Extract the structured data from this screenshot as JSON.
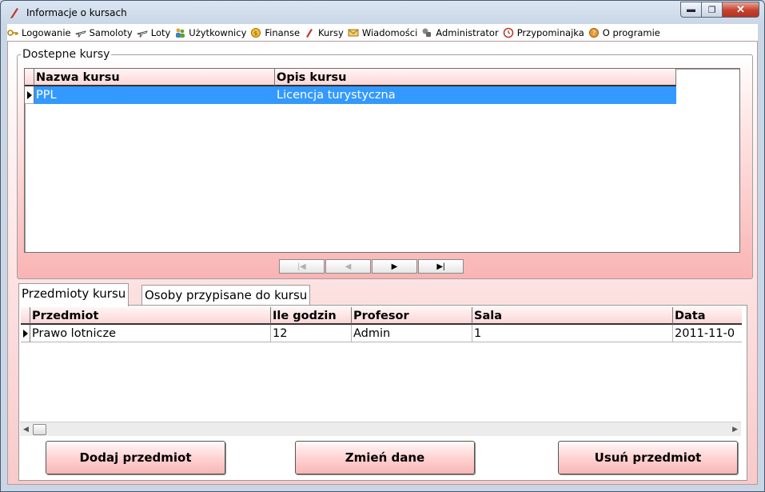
{
  "window": {
    "title": "Informacje o kursach"
  },
  "menu": [
    {
      "label": "Logowanie",
      "icon": "key-icon"
    },
    {
      "label": "Samoloty",
      "icon": "plane-icon"
    },
    {
      "label": "Loty",
      "icon": "plane-icon"
    },
    {
      "label": "Użytkownicy",
      "icon": "users-icon"
    },
    {
      "label": "Finanse",
      "icon": "coin-icon"
    },
    {
      "label": "Kursy",
      "icon": "pen-icon"
    },
    {
      "label": "Wiadomości",
      "icon": "envelope-icon"
    },
    {
      "label": "Administrator",
      "icon": "admin-icon"
    },
    {
      "label": "Przypominajka",
      "icon": "clock-icon"
    },
    {
      "label": "O programie",
      "icon": "info-icon"
    }
  ],
  "courses": {
    "group_title": "Dostepne kursy",
    "columns": [
      "Nazwa kursu",
      "Opis kursu"
    ],
    "rows": [
      [
        "PPL",
        "Licencja turystyczna"
      ]
    ],
    "nav": {
      "first": "|◀",
      "prev": "◀",
      "next": "▶",
      "last": "▶|"
    }
  },
  "tabs": [
    {
      "label": "Przedmioty kursu",
      "active": true
    },
    {
      "label": "Osoby przypisane do kursu",
      "active": false
    }
  ],
  "subjects": {
    "columns": [
      "Przedmiot",
      "Ile godzin",
      "Profesor",
      "Sala",
      "Data"
    ],
    "rows": [
      [
        "Prawo lotnicze",
        "12",
        "Admin",
        "1",
        "2011-11-0"
      ]
    ]
  },
  "buttons": {
    "add": "Dodaj przedmiot",
    "edit": "Zmień dane",
    "delete": "Usuń przedmiot"
  },
  "colors": {
    "selection": "#3399ff",
    "accent_pink": "#f9b7b7"
  }
}
